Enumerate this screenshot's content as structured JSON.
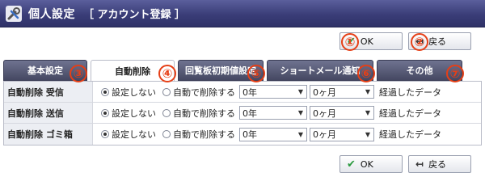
{
  "header": {
    "title": "個人設定",
    "subtitle": "［ アカウント登録 ］",
    "icon": "wrench-screwdriver-icon"
  },
  "top_buttons": {
    "ok": "OK",
    "back": "戻る"
  },
  "bottom_buttons": {
    "ok": "OK",
    "back": "戻る"
  },
  "markers": [
    "①",
    "②",
    "③",
    "④",
    "⑤",
    "⑥",
    "⑦"
  ],
  "tabs": [
    {
      "label": "基本設定",
      "active": false
    },
    {
      "label": "自動削除",
      "active": true
    },
    {
      "label": "回覧板初期値設定",
      "active": false
    },
    {
      "label": "ショートメール通知",
      "active": false
    },
    {
      "label": "その他",
      "active": false
    }
  ],
  "rows": [
    {
      "label": "自動削除 受信",
      "opt_off": "設定しない",
      "opt_on": "自動で削除する",
      "year": "0年",
      "month": "0ヶ月",
      "suffix": "経過したデータ",
      "selected": "off"
    },
    {
      "label": "自動削除 送信",
      "opt_off": "設定しない",
      "opt_on": "自動で削除する",
      "year": "0年",
      "month": "0ヶ月",
      "suffix": "経過したデータ",
      "selected": "off"
    },
    {
      "label": "自動削除 ゴミ箱",
      "opt_off": "設定しない",
      "opt_on": "自動で削除する",
      "year": "0年",
      "month": "0ヶ月",
      "suffix": "経過したデータ",
      "selected": "off"
    }
  ],
  "colors": {
    "header": "#3a3d78",
    "tab": "#5a5d78",
    "marker": "#e63f16",
    "ok_icon": "#2b9a3f"
  }
}
